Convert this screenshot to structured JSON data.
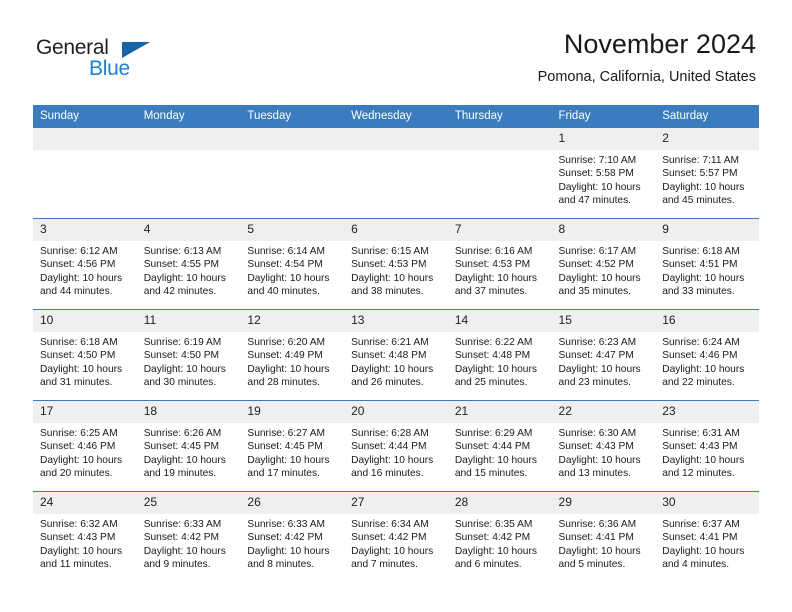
{
  "brand": {
    "name_part1": "General",
    "name_part2": "Blue",
    "triangle_color": "#1565a8",
    "blue_color": "#1f7fd0"
  },
  "header": {
    "title": "November 2024",
    "subtitle": "Pomona, California, United States"
  },
  "theme": {
    "header_row_bg": "#3a7cbe",
    "daynum_bg": "#efefef",
    "cell_bg": "#ffffff",
    "text_color": "#1a1a1a"
  },
  "weekday_headers": [
    "Sunday",
    "Monday",
    "Tuesday",
    "Wednesday",
    "Thursday",
    "Friday",
    "Saturday"
  ],
  "labels": {
    "sunrise_prefix": "Sunrise:",
    "sunset_prefix": "Sunset:",
    "daylight_prefix": "Daylight:"
  },
  "weeks": [
    [
      {
        "day": "",
        "empty": true
      },
      {
        "day": "",
        "empty": true
      },
      {
        "day": "",
        "empty": true
      },
      {
        "day": "",
        "empty": true
      },
      {
        "day": "",
        "empty": true
      },
      {
        "day": "1",
        "sunrise": "Sunrise: 7:10 AM",
        "sunset": "Sunset: 5:58 PM",
        "daylight": "Daylight: 10 hours and 47 minutes."
      },
      {
        "day": "2",
        "sunrise": "Sunrise: 7:11 AM",
        "sunset": "Sunset: 5:57 PM",
        "daylight": "Daylight: 10 hours and 45 minutes."
      }
    ],
    [
      {
        "day": "3",
        "sunrise": "Sunrise: 6:12 AM",
        "sunset": "Sunset: 4:56 PM",
        "daylight": "Daylight: 10 hours and 44 minutes."
      },
      {
        "day": "4",
        "sunrise": "Sunrise: 6:13 AM",
        "sunset": "Sunset: 4:55 PM",
        "daylight": "Daylight: 10 hours and 42 minutes."
      },
      {
        "day": "5",
        "sunrise": "Sunrise: 6:14 AM",
        "sunset": "Sunset: 4:54 PM",
        "daylight": "Daylight: 10 hours and 40 minutes."
      },
      {
        "day": "6",
        "sunrise": "Sunrise: 6:15 AM",
        "sunset": "Sunset: 4:53 PM",
        "daylight": "Daylight: 10 hours and 38 minutes."
      },
      {
        "day": "7",
        "sunrise": "Sunrise: 6:16 AM",
        "sunset": "Sunset: 4:53 PM",
        "daylight": "Daylight: 10 hours and 37 minutes."
      },
      {
        "day": "8",
        "sunrise": "Sunrise: 6:17 AM",
        "sunset": "Sunset: 4:52 PM",
        "daylight": "Daylight: 10 hours and 35 minutes."
      },
      {
        "day": "9",
        "sunrise": "Sunrise: 6:18 AM",
        "sunset": "Sunset: 4:51 PM",
        "daylight": "Daylight: 10 hours and 33 minutes."
      }
    ],
    [
      {
        "day": "10",
        "sunrise": "Sunrise: 6:18 AM",
        "sunset": "Sunset: 4:50 PM",
        "daylight": "Daylight: 10 hours and 31 minutes."
      },
      {
        "day": "11",
        "sunrise": "Sunrise: 6:19 AM",
        "sunset": "Sunset: 4:50 PM",
        "daylight": "Daylight: 10 hours and 30 minutes."
      },
      {
        "day": "12",
        "sunrise": "Sunrise: 6:20 AM",
        "sunset": "Sunset: 4:49 PM",
        "daylight": "Daylight: 10 hours and 28 minutes."
      },
      {
        "day": "13",
        "sunrise": "Sunrise: 6:21 AM",
        "sunset": "Sunset: 4:48 PM",
        "daylight": "Daylight: 10 hours and 26 minutes."
      },
      {
        "day": "14",
        "sunrise": "Sunrise: 6:22 AM",
        "sunset": "Sunset: 4:48 PM",
        "daylight": "Daylight: 10 hours and 25 minutes."
      },
      {
        "day": "15",
        "sunrise": "Sunrise: 6:23 AM",
        "sunset": "Sunset: 4:47 PM",
        "daylight": "Daylight: 10 hours and 23 minutes."
      },
      {
        "day": "16",
        "sunrise": "Sunrise: 6:24 AM",
        "sunset": "Sunset: 4:46 PM",
        "daylight": "Daylight: 10 hours and 22 minutes."
      }
    ],
    [
      {
        "day": "17",
        "sunrise": "Sunrise: 6:25 AM",
        "sunset": "Sunset: 4:46 PM",
        "daylight": "Daylight: 10 hours and 20 minutes."
      },
      {
        "day": "18",
        "sunrise": "Sunrise: 6:26 AM",
        "sunset": "Sunset: 4:45 PM",
        "daylight": "Daylight: 10 hours and 19 minutes."
      },
      {
        "day": "19",
        "sunrise": "Sunrise: 6:27 AM",
        "sunset": "Sunset: 4:45 PM",
        "daylight": "Daylight: 10 hours and 17 minutes."
      },
      {
        "day": "20",
        "sunrise": "Sunrise: 6:28 AM",
        "sunset": "Sunset: 4:44 PM",
        "daylight": "Daylight: 10 hours and 16 minutes."
      },
      {
        "day": "21",
        "sunrise": "Sunrise: 6:29 AM",
        "sunset": "Sunset: 4:44 PM",
        "daylight": "Daylight: 10 hours and 15 minutes."
      },
      {
        "day": "22",
        "sunrise": "Sunrise: 6:30 AM",
        "sunset": "Sunset: 4:43 PM",
        "daylight": "Daylight: 10 hours and 13 minutes."
      },
      {
        "day": "23",
        "sunrise": "Sunrise: 6:31 AM",
        "sunset": "Sunset: 4:43 PM",
        "daylight": "Daylight: 10 hours and 12 minutes."
      }
    ],
    [
      {
        "day": "24",
        "sunrise": "Sunrise: 6:32 AM",
        "sunset": "Sunset: 4:43 PM",
        "daylight": "Daylight: 10 hours and 11 minutes."
      },
      {
        "day": "25",
        "sunrise": "Sunrise: 6:33 AM",
        "sunset": "Sunset: 4:42 PM",
        "daylight": "Daylight: 10 hours and 9 minutes."
      },
      {
        "day": "26",
        "sunrise": "Sunrise: 6:33 AM",
        "sunset": "Sunset: 4:42 PM",
        "daylight": "Daylight: 10 hours and 8 minutes."
      },
      {
        "day": "27",
        "sunrise": "Sunrise: 6:34 AM",
        "sunset": "Sunset: 4:42 PM",
        "daylight": "Daylight: 10 hours and 7 minutes."
      },
      {
        "day": "28",
        "sunrise": "Sunrise: 6:35 AM",
        "sunset": "Sunset: 4:42 PM",
        "daylight": "Daylight: 10 hours and 6 minutes."
      },
      {
        "day": "29",
        "sunrise": "Sunrise: 6:36 AM",
        "sunset": "Sunset: 4:41 PM",
        "daylight": "Daylight: 10 hours and 5 minutes."
      },
      {
        "day": "30",
        "sunrise": "Sunrise: 6:37 AM",
        "sunset": "Sunset: 4:41 PM",
        "daylight": "Daylight: 10 hours and 4 minutes."
      }
    ]
  ]
}
